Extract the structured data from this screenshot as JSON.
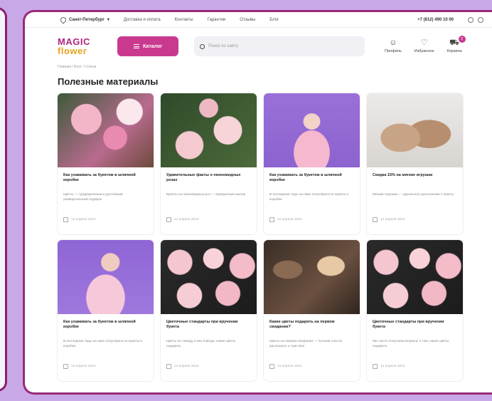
{
  "topbar": {
    "city": "Санкт-Петербург",
    "links": [
      "Доставка и оплата",
      "Контакты",
      "Гарантии",
      "Отзывы",
      "Блог"
    ],
    "phone": "+7 (812) 490 10 00"
  },
  "header": {
    "logo_line1": "MAGIC",
    "logo_line2": "flower",
    "catalog_label": "Каталог",
    "search_placeholder": "Поиск по сайту",
    "nav": [
      {
        "label": "Профиль",
        "icon": "user-icon"
      },
      {
        "label": "Избранное",
        "icon": "heart-icon"
      },
      {
        "label": "Корзина",
        "icon": "cart-icon",
        "badge": "2"
      }
    ]
  },
  "breadcrumb": "Главная  /  Блог  /  Статьи",
  "page_title": "Полезные материалы",
  "cards": [
    {
      "title": "Как ухаживать за букетом в шляпной коробке",
      "text": "Цветы — традиционный и достойный универсальный подарок",
      "date": "12 апреля 2024"
    },
    {
      "title": "Удивительные факты о пионовидных розах",
      "text": "Букеты из пионовидных роз — прекрасный выбор",
      "date": "12 апреля 2024"
    },
    {
      "title": "Как ухаживать за букетом в шляпной коробке",
      "text": "В последние годы на пике популярности букеты в коробке",
      "date": "12 апреля 2024"
    },
    {
      "title": "Скидка 15% на мягкие игрушки",
      "text": "Мягкие игрушки — идеальное дополнение к букету",
      "date": "12 апреля 2024"
    },
    {
      "title": "Как ухаживать за букетом в шляпной коробке",
      "text": "В последние годы на пике популярности букеты в коробке",
      "date": "12 апреля 2024"
    },
    {
      "title": "Цветочные стандарты при вручении букета",
      "text": "Цветы по поводу и без повода: какие цветы подарить",
      "date": "12 апреля 2024"
    },
    {
      "title": "Какие цветы подарить на первом свидании?",
      "text": "Цветы на первом свидании — лучший способ рассказать о чувствах",
      "date": "12 апреля 2024"
    },
    {
      "title": "Цветочные стандарты при вручении букета",
      "text": "Мы часто получаем вопросы о том, какие цветы подарить",
      "date": "12 апреля 2024"
    }
  ],
  "colors": {
    "accent": "#c93a8f",
    "frame": "#9a2a78",
    "background": "#c9a8e8"
  }
}
